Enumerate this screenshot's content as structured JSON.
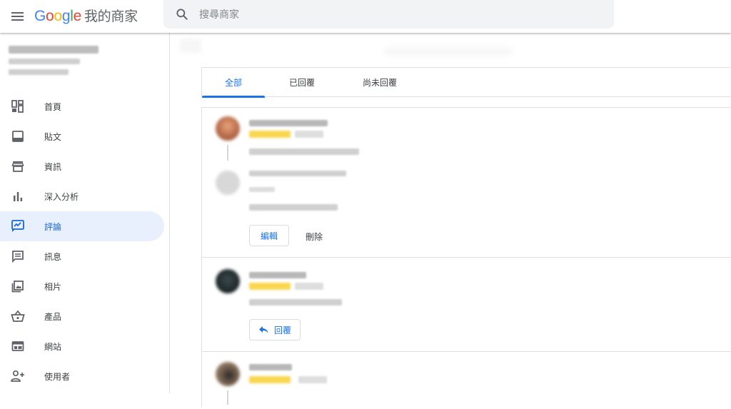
{
  "app": {
    "brand_letters": [
      "G",
      "o",
      "o",
      "g",
      "l",
      "e"
    ],
    "product_name": "我的商家"
  },
  "search": {
    "placeholder": "搜尋商家"
  },
  "sidebar": {
    "items": [
      {
        "label": "首頁",
        "icon": "dashboard-icon"
      },
      {
        "label": "貼文",
        "icon": "post-icon"
      },
      {
        "label": "資訊",
        "icon": "store-icon"
      },
      {
        "label": "深入分析",
        "icon": "bar-chart-icon"
      },
      {
        "label": "評論",
        "icon": "review-icon",
        "active": true
      },
      {
        "label": "訊息",
        "icon": "message-icon"
      },
      {
        "label": "相片",
        "icon": "photo-icon"
      },
      {
        "label": "產品",
        "icon": "basket-icon"
      },
      {
        "label": "網站",
        "icon": "website-icon"
      },
      {
        "label": "使用者",
        "icon": "add-user-icon"
      }
    ]
  },
  "tabs": {
    "all": "全部",
    "replied": "已回覆",
    "unreplied": "尚未回覆"
  },
  "reviews": {
    "edit_label": "編輯",
    "delete_label": "刪除",
    "reply_label": "回覆"
  },
  "colors": {
    "accent": "#1a73e8",
    "active_bg": "#e8f0fe",
    "star": "#f9d64f"
  }
}
